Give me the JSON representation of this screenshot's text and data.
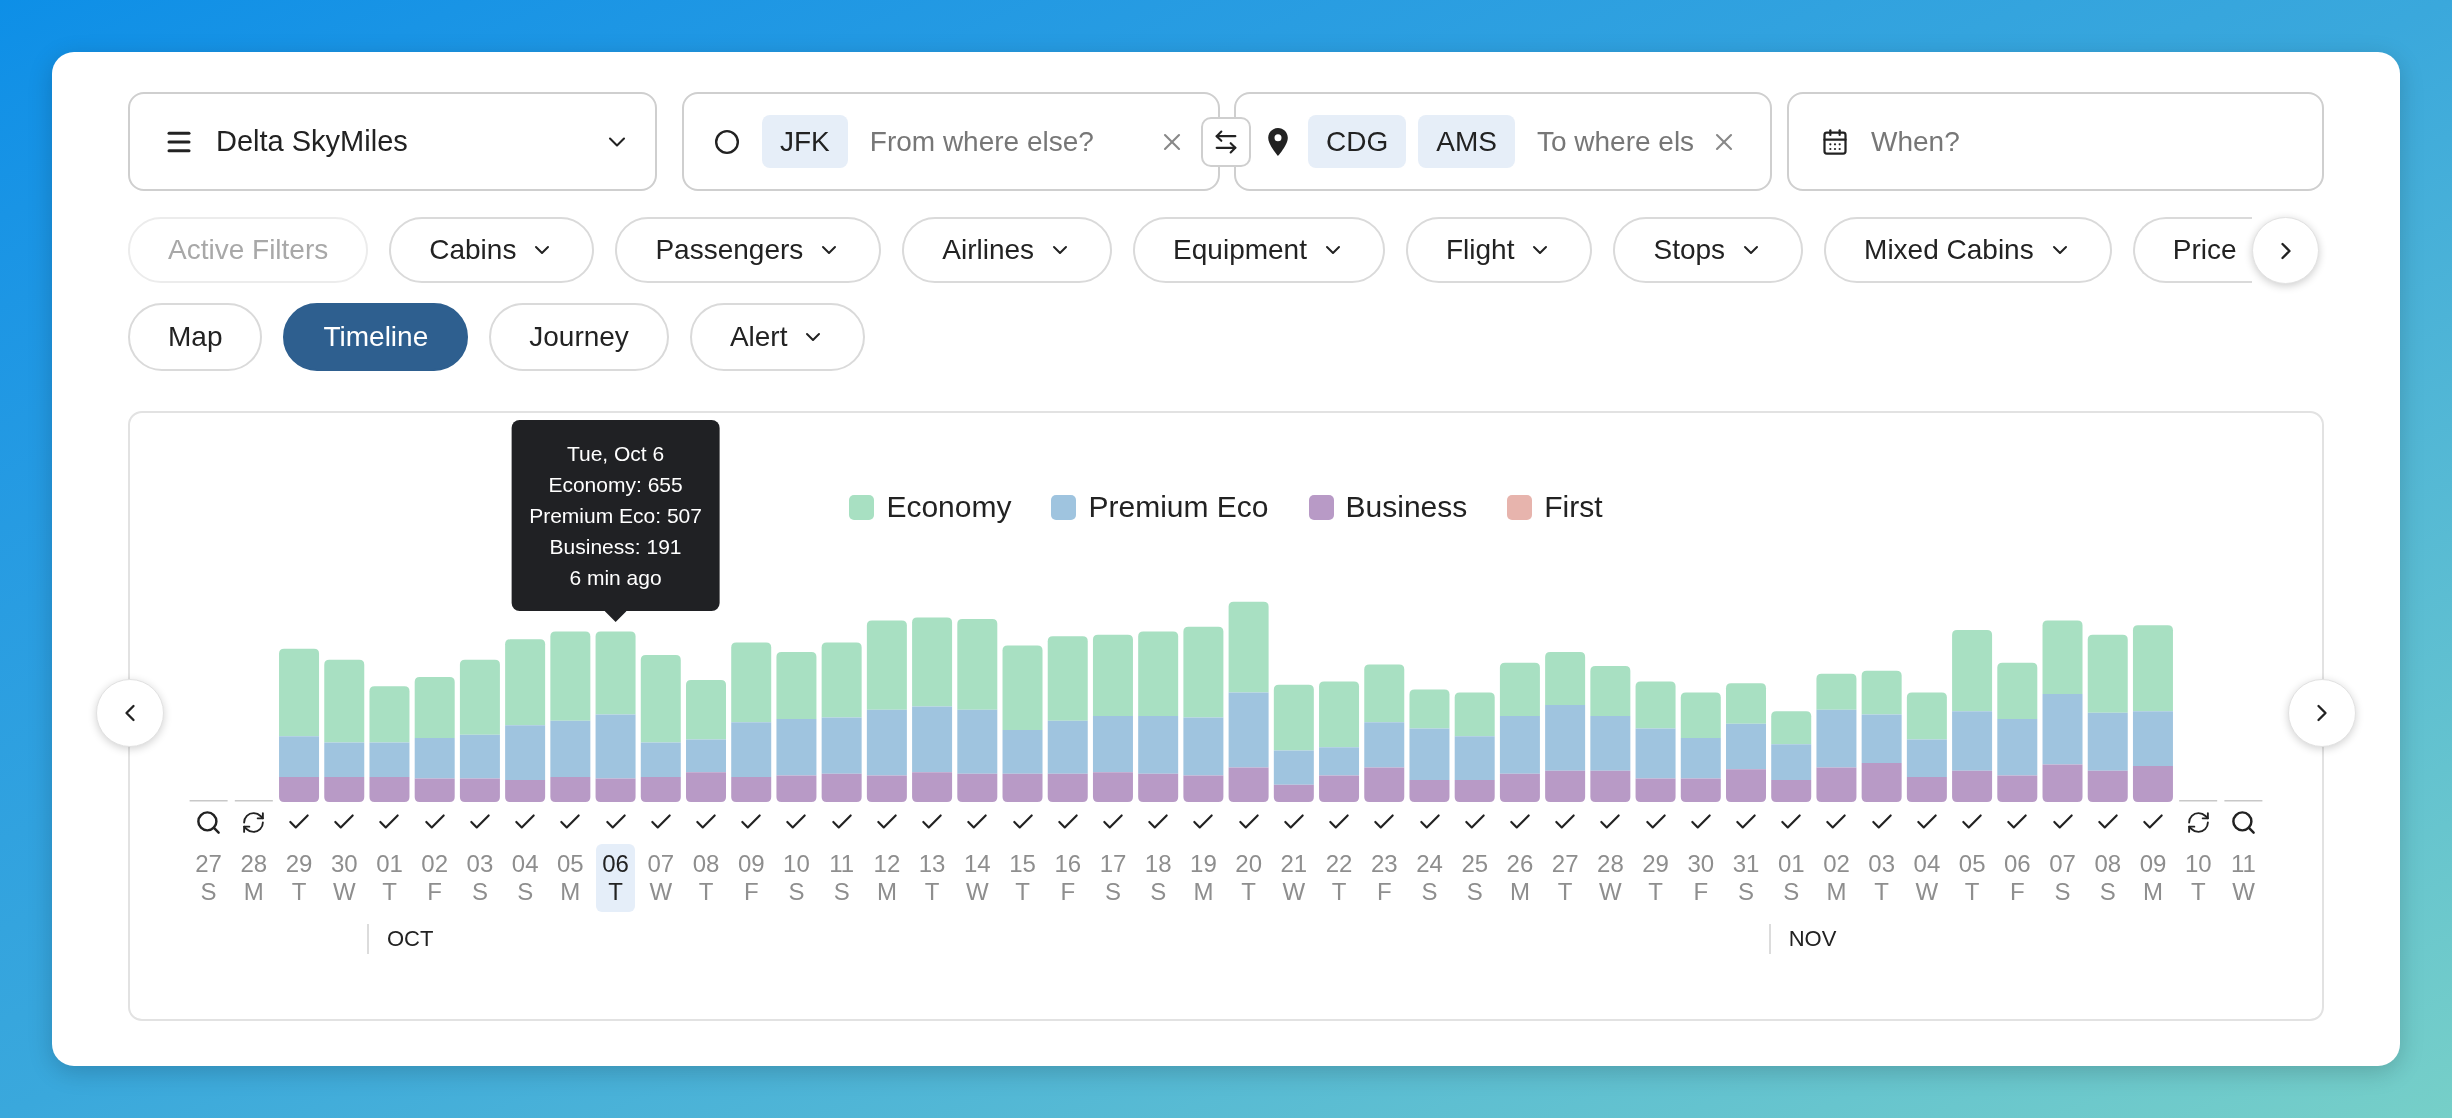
{
  "program_select": {
    "label": "Delta SkyMiles"
  },
  "origin": {
    "airports": [
      "JFK"
    ],
    "placeholder": "From where else?"
  },
  "destination": {
    "airports": [
      "CDG",
      "AMS"
    ],
    "placeholder": "To where els"
  },
  "dates": {
    "placeholder": "When?"
  },
  "filters": [
    {
      "label": "Active Filters",
      "disabled": true,
      "dropdown": false
    },
    {
      "label": "Cabins",
      "disabled": false,
      "dropdown": true
    },
    {
      "label": "Passengers",
      "disabled": false,
      "dropdown": true
    },
    {
      "label": "Airlines",
      "disabled": false,
      "dropdown": true
    },
    {
      "label": "Equipment",
      "disabled": false,
      "dropdown": true
    },
    {
      "label": "Flight",
      "disabled": false,
      "dropdown": true
    },
    {
      "label": "Stops",
      "disabled": false,
      "dropdown": true
    },
    {
      "label": "Mixed Cabins",
      "disabled": false,
      "dropdown": true
    },
    {
      "label": "Price",
      "disabled": false,
      "dropdown": false
    }
  ],
  "views": [
    {
      "label": "Map",
      "selected": false,
      "dropdown": false
    },
    {
      "label": "Timeline",
      "selected": true,
      "dropdown": false
    },
    {
      "label": "Journey",
      "selected": false,
      "dropdown": false
    },
    {
      "label": "Alert",
      "selected": false,
      "dropdown": true
    }
  ],
  "chart": {
    "legend": [
      {
        "label": "Economy",
        "color": "#a8e0c2"
      },
      {
        "label": "Premium Eco",
        "color": "#9fc4df"
      },
      {
        "label": "Business",
        "color": "#b89ac6"
      },
      {
        "label": "First",
        "color": "#e7b4ad"
      }
    ],
    "tooltip": {
      "lines": [
        "Tue, Oct 6",
        "Economy: 655",
        "Premium Eco: 507",
        "Business: 191",
        "6 min ago"
      ]
    },
    "days": [
      {
        "date": "27",
        "weekday": "S",
        "kind": "search",
        "selected": false
      },
      {
        "date": "28",
        "weekday": "M",
        "kind": "refresh",
        "selected": false
      },
      {
        "date": "29",
        "weekday": "T",
        "kind": "check",
        "selected": false
      },
      {
        "date": "30",
        "weekday": "W",
        "kind": "check",
        "selected": false
      },
      {
        "date": "01",
        "weekday": "T",
        "kind": "check",
        "selected": false,
        "month": "OCT"
      },
      {
        "date": "02",
        "weekday": "F",
        "kind": "check",
        "selected": false
      },
      {
        "date": "03",
        "weekday": "S",
        "kind": "check",
        "selected": false
      },
      {
        "date": "04",
        "weekday": "S",
        "kind": "check",
        "selected": false
      },
      {
        "date": "05",
        "weekday": "M",
        "kind": "check",
        "selected": false
      },
      {
        "date": "06",
        "weekday": "T",
        "kind": "check",
        "selected": true
      },
      {
        "date": "07",
        "weekday": "W",
        "kind": "check",
        "selected": false
      },
      {
        "date": "08",
        "weekday": "T",
        "kind": "check",
        "selected": false
      },
      {
        "date": "09",
        "weekday": "F",
        "kind": "check",
        "selected": false
      },
      {
        "date": "10",
        "weekday": "S",
        "kind": "check",
        "selected": false
      },
      {
        "date": "11",
        "weekday": "S",
        "kind": "check",
        "selected": false
      },
      {
        "date": "12",
        "weekday": "M",
        "kind": "check",
        "selected": false
      },
      {
        "date": "13",
        "weekday": "T",
        "kind": "check",
        "selected": false
      },
      {
        "date": "14",
        "weekday": "W",
        "kind": "check",
        "selected": false
      },
      {
        "date": "15",
        "weekday": "T",
        "kind": "check",
        "selected": false
      },
      {
        "date": "16",
        "weekday": "F",
        "kind": "check",
        "selected": false
      },
      {
        "date": "17",
        "weekday": "S",
        "kind": "check",
        "selected": false
      },
      {
        "date": "18",
        "weekday": "S",
        "kind": "check",
        "selected": false
      },
      {
        "date": "19",
        "weekday": "M",
        "kind": "check",
        "selected": false
      },
      {
        "date": "20",
        "weekday": "T",
        "kind": "check",
        "selected": false
      },
      {
        "date": "21",
        "weekday": "W",
        "kind": "check",
        "selected": false
      },
      {
        "date": "22",
        "weekday": "T",
        "kind": "check",
        "selected": false
      },
      {
        "date": "23",
        "weekday": "F",
        "kind": "check",
        "selected": false
      },
      {
        "date": "24",
        "weekday": "S",
        "kind": "check",
        "selected": false
      },
      {
        "date": "25",
        "weekday": "S",
        "kind": "check",
        "selected": false
      },
      {
        "date": "26",
        "weekday": "M",
        "kind": "check",
        "selected": false
      },
      {
        "date": "27",
        "weekday": "T",
        "kind": "check",
        "selected": false
      },
      {
        "date": "28",
        "weekday": "W",
        "kind": "check",
        "selected": false
      },
      {
        "date": "29",
        "weekday": "T",
        "kind": "check",
        "selected": false
      },
      {
        "date": "30",
        "weekday": "F",
        "kind": "check",
        "selected": false
      },
      {
        "date": "31",
        "weekday": "S",
        "kind": "check",
        "selected": false
      },
      {
        "date": "01",
        "weekday": "S",
        "kind": "check",
        "selected": false,
        "month": "NOV"
      },
      {
        "date": "02",
        "weekday": "M",
        "kind": "check",
        "selected": false
      },
      {
        "date": "03",
        "weekday": "T",
        "kind": "check",
        "selected": false
      },
      {
        "date": "04",
        "weekday": "W",
        "kind": "check",
        "selected": false
      },
      {
        "date": "05",
        "weekday": "T",
        "kind": "check",
        "selected": false
      },
      {
        "date": "06",
        "weekday": "F",
        "kind": "check",
        "selected": false
      },
      {
        "date": "07",
        "weekday": "S",
        "kind": "check",
        "selected": false
      },
      {
        "date": "08",
        "weekday": "S",
        "kind": "check",
        "selected": false
      },
      {
        "date": "09",
        "weekday": "M",
        "kind": "check",
        "selected": false
      },
      {
        "date": "10",
        "weekday": "T",
        "kind": "refresh",
        "selected": false
      },
      {
        "date": "11",
        "weekday": "W",
        "kind": "search",
        "selected": false
      }
    ]
  }
}
